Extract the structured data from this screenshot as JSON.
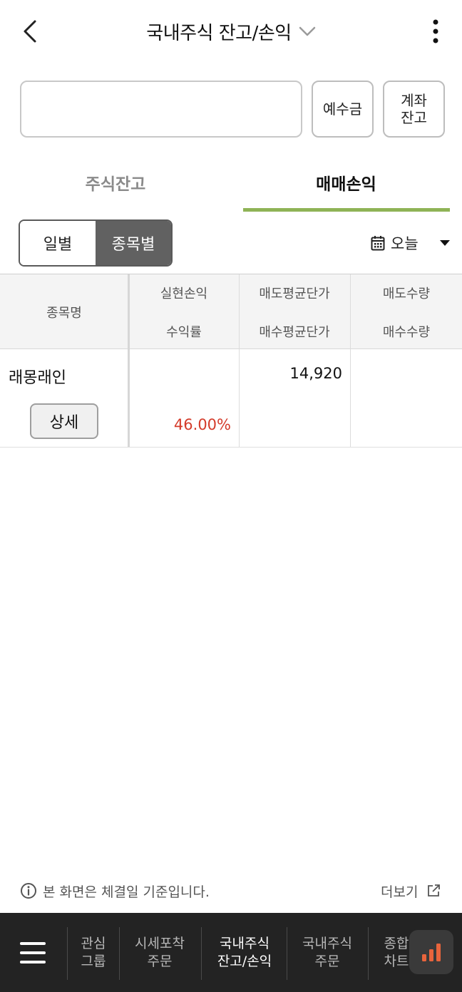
{
  "header": {
    "title": "국내주식 잔고/손익",
    "back_icon": "chevron-left-icon",
    "dropdown_icon": "chevron-down-icon",
    "more_icon": "kebab-menu-icon"
  },
  "account": {
    "value": "",
    "deposit_label": "예수금",
    "balance_label_line1": "계좌",
    "balance_label_line2": "잔고"
  },
  "tabs": [
    {
      "label": "주식잔고",
      "active": false
    },
    {
      "label": "매매손익",
      "active": true
    }
  ],
  "segment": {
    "daily_label": "일별",
    "by_stock_label": "종목별",
    "active": "종목별"
  },
  "date_filter": {
    "label": "오늘",
    "icon": "calendar-icon",
    "caret": "caret-down-icon"
  },
  "table": {
    "col_name": "종목명",
    "col_realized_pnl": "실현손익",
    "col_return_rate": "수익률",
    "col_avg_sell_price": "매도평균단가",
    "col_avg_buy_price": "매수평균단가",
    "col_sell_qty": "매도수량",
    "col_buy_qty": "매수수량",
    "rows": [
      {
        "name": "래몽래인",
        "detail_label": "상세",
        "realized_pnl": "",
        "return_rate": "46.00%",
        "avg_sell_price": "14,920",
        "avg_buy_price": "",
        "sell_qty": "",
        "buy_qty": ""
      }
    ]
  },
  "footer_notice": {
    "text": "본 화면은 체결일 기준입니다.",
    "more_label": "더보기",
    "info_icon": "info-circle-icon",
    "external_icon": "external-link-icon"
  },
  "bottom_nav": {
    "menu_icon": "hamburger-menu-icon",
    "items": [
      {
        "line1": "관심",
        "line2": "그룹",
        "active": false
      },
      {
        "line1": "시세포착",
        "line2": "주문",
        "active": false
      },
      {
        "line1": "국내주식",
        "line2": "잔고/손익",
        "active": true
      },
      {
        "line1": "국내주식",
        "line2": "주문",
        "active": false
      },
      {
        "line1": "종합",
        "line2": "차트",
        "active": false
      }
    ],
    "fab_icon": "bar-chart-icon"
  },
  "colors": {
    "accent_green": "#8fb356",
    "profit_red": "#d43b2a",
    "nav_bg": "#232323",
    "fab_icon_orange": "#e8643c"
  }
}
